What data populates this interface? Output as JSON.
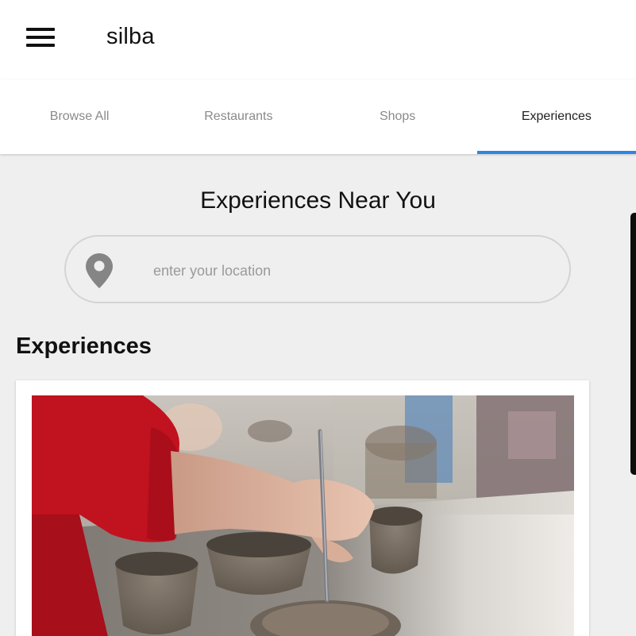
{
  "app": {
    "title": "silba"
  },
  "tabs": [
    {
      "label": "Browse All",
      "active": false
    },
    {
      "label": "Restaurants",
      "active": false
    },
    {
      "label": "Shops",
      "active": false
    },
    {
      "label": "Experiences",
      "active": true
    }
  ],
  "main": {
    "headline": "Experiences Near You",
    "search": {
      "placeholder": "enter your location",
      "value": "",
      "icon": "location-pin-icon"
    },
    "section_title": "Experiences",
    "cards": [
      {
        "image": "pottery-workshop-photo"
      }
    ]
  },
  "colors": {
    "accent": "#2b87e3",
    "background": "#efefef",
    "header": "#ffffff",
    "tab_inactive": "#8a8a8a",
    "tab_active": "#222222"
  }
}
